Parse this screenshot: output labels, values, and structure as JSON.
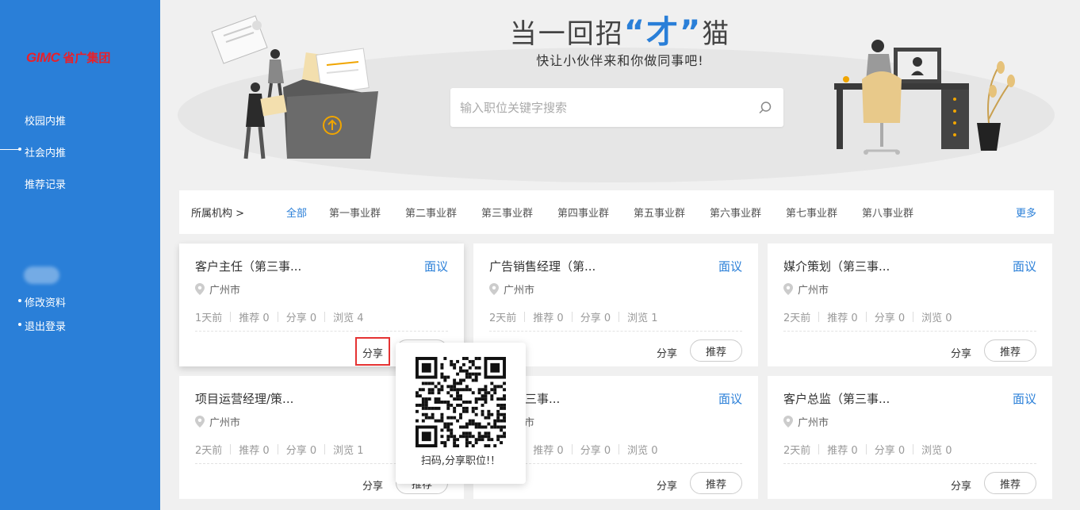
{
  "sidebar": {
    "logo_mark": "GIMC",
    "logo_text": "省广集团",
    "nav": [
      {
        "label": "校园内推"
      },
      {
        "label": "社会内推"
      },
      {
        "label": "推荐记录"
      }
    ],
    "account": [
      {
        "label": "修改资料"
      },
      {
        "label": "退出登录"
      }
    ]
  },
  "banner": {
    "title_pre": "当一回招",
    "title_hl": "“才”",
    "title_post": "猫",
    "subtitle": "快让小伙伴来和你做同事吧!",
    "search_placeholder": "输入职位关键字搜索"
  },
  "filter": {
    "label": "所属机构  >",
    "options": [
      "全部",
      "第一事业群",
      "第二事业群",
      "第三事业群",
      "第四事业群",
      "第五事业群",
      "第六事业群",
      "第七事业群",
      "第八事业群"
    ],
    "active": "全部",
    "more": "更多"
  },
  "cards": [
    {
      "title": "客户主任（第三事...",
      "salary": "面议",
      "location": "广州市",
      "time": "1天前",
      "recommend": "推荐 0",
      "share": "分享 0",
      "views": "浏览 4",
      "share_btn": "分享",
      "recommend_btn": "推荐"
    },
    {
      "title": "广告销售经理（第...",
      "salary": "面议",
      "location": "广州市",
      "time": "2天前",
      "recommend": "推荐 0",
      "share": "分享 0",
      "views": "浏览 1",
      "share_btn": "分享",
      "recommend_btn": "推荐"
    },
    {
      "title": "媒介策划（第三事...",
      "salary": "面议",
      "location": "广州市",
      "time": "2天前",
      "recommend": "推荐 0",
      "share": "分享 0",
      "views": "浏览 0",
      "share_btn": "分享",
      "recommend_btn": "推荐"
    },
    {
      "title": "项目运营经理/策...",
      "salary": "",
      "location": "广州市",
      "time": "2天前",
      "recommend": "推荐 0",
      "share": "分享 0",
      "views": "浏览 1",
      "share_btn": "分享",
      "recommend_btn": "推荐"
    },
    {
      "title": "理（第三事...",
      "salary": "面议",
      "location": "广州市",
      "time": "2天前",
      "recommend": "推荐 0",
      "share": "分享 0",
      "views": "浏览 0",
      "share_btn": "分享",
      "recommend_btn": "推荐"
    },
    {
      "title": "客户总监（第三事...",
      "salary": "面议",
      "location": "广州市",
      "time": "2天前",
      "recommend": "推荐 0",
      "share": "分享 0",
      "views": "浏览 0",
      "share_btn": "分享",
      "recommend_btn": "推荐"
    }
  ],
  "qr_popup": {
    "caption": "扫码,分享职位!！"
  },
  "colors": {
    "sidebar": "#2a7fd8",
    "accent": "#2a7fd8",
    "highlight": "#e53333"
  }
}
